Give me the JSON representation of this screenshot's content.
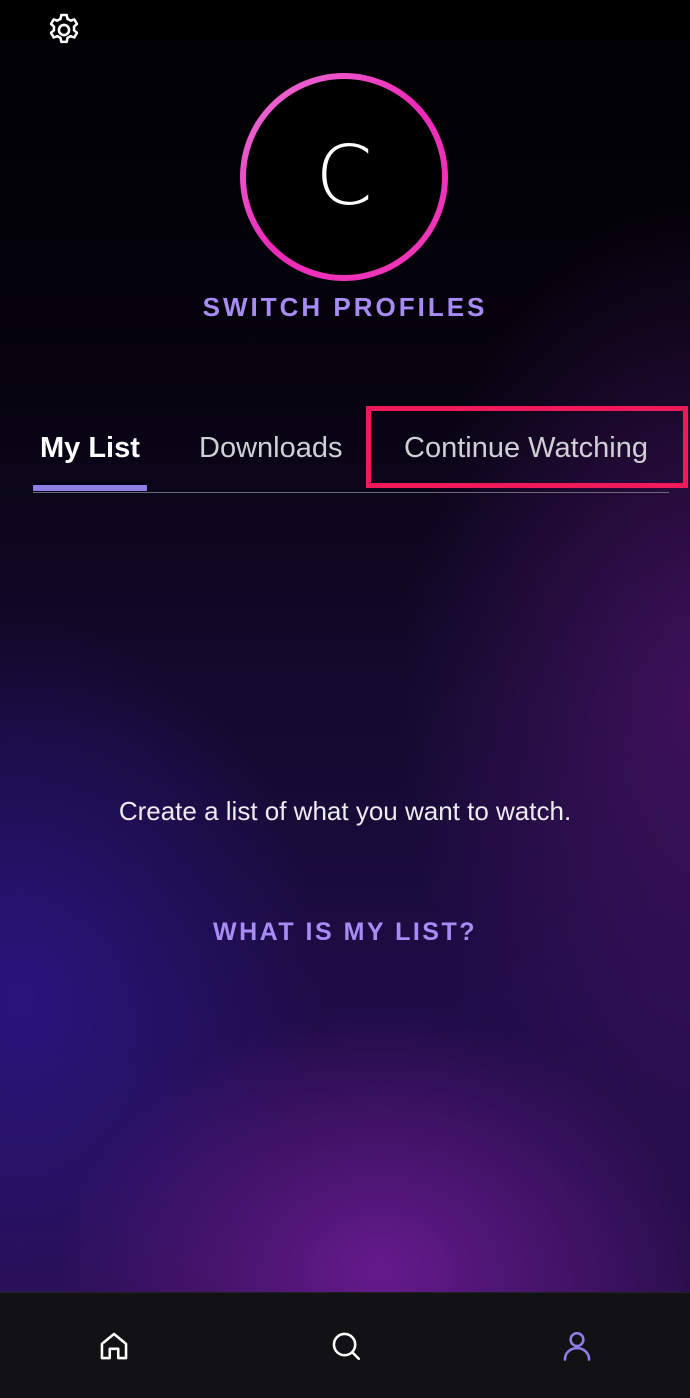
{
  "profile": {
    "initial": "C",
    "switch_label": "SWITCH PROFILES"
  },
  "tabs": [
    {
      "label": "My List",
      "active": true
    },
    {
      "label": "Downloads",
      "active": false
    },
    {
      "label": "Continue Watching",
      "active": false,
      "highlighted": true
    }
  ],
  "empty_state": {
    "message": "Create a list of what you want to watch.",
    "link": "WHAT IS MY LIST?"
  },
  "icons": {
    "settings": "gear-icon",
    "nav_home": "home-icon",
    "nav_search": "search-icon",
    "nav_profile": "profile-icon"
  },
  "colors": {
    "accent": "#a88cf5",
    "tab_indicator": "#8d7ee8",
    "avatar_ring": "#ee2ab9",
    "highlight_box": "#f01a5a",
    "active_nav_icon": "#8d7ee8"
  }
}
